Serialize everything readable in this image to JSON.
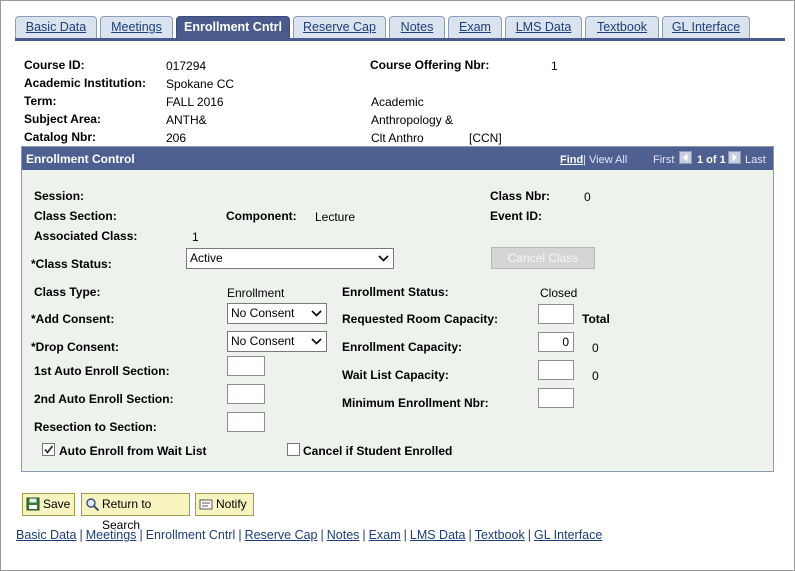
{
  "tabs": [
    {
      "label": "Basic Data",
      "active": false
    },
    {
      "label": "Meetings",
      "active": false
    },
    {
      "label": "Enrollment Cntrl",
      "active": true
    },
    {
      "label": "Reserve Cap",
      "active": false
    },
    {
      "label": "Notes",
      "active": false
    },
    {
      "label": "Exam",
      "active": false
    },
    {
      "label": "LMS Data",
      "active": false
    },
    {
      "label": "Textbook",
      "active": false
    },
    {
      "label": "GL Interface",
      "active": false
    }
  ],
  "header": {
    "course_id_label": "Course ID:",
    "course_id": "017294",
    "course_offering_label": "Course Offering Nbr:",
    "course_offering": "1",
    "institution_label": "Academic Institution:",
    "institution": "Spokane CC",
    "term_label": "Term:",
    "term": "FALL 2016",
    "term_extra": "Academic",
    "subject_label": "Subject Area:",
    "subject": "ANTH&",
    "subject_extra": "Anthropology &",
    "catalog_label": "Catalog Nbr:",
    "catalog": "206",
    "catalog_extra": "Clt Anthro",
    "catalog_tag": "[CCN]"
  },
  "enrollment": {
    "title": "Enrollment Control",
    "nav": {
      "find": "Find",
      "view_all": "View All",
      "first": "First",
      "pos": "1 of 1",
      "last": "Last",
      "sep": "|"
    },
    "session_label": "Session:",
    "class_nbr_label": "Class Nbr:",
    "class_nbr": "0",
    "class_section_label": "Class Section:",
    "component_label": "Component:",
    "component": "Lecture",
    "event_id_label": "Event ID:",
    "assoc_class_label": "Associated Class:",
    "assoc_class": "1",
    "class_status_label": "*Class Status:",
    "class_status": "Active",
    "cancel_class": "Cancel Class",
    "class_type_label": "Class Type:",
    "class_type": "Enrollment",
    "enroll_status_label": "Enrollment Status:",
    "enroll_status": "Closed",
    "add_consent_label": "*Add Consent:",
    "add_consent": "No Consent",
    "req_room_label": "Requested Room Capacity:",
    "req_room": "",
    "total_label": "Total",
    "drop_consent_label": "*Drop Consent:",
    "drop_consent": "No Consent",
    "enroll_cap_label": "Enrollment Capacity:",
    "enroll_cap": "0",
    "enroll_total": "0",
    "auto1_label": "1st Auto Enroll Section:",
    "auto1": "",
    "waitlist_label": "Wait List Capacity:",
    "waitlist": "",
    "waitlist_total": "0",
    "auto2_label": "2nd Auto Enroll Section:",
    "auto2": "",
    "min_enroll_label": "Minimum Enrollment Nbr:",
    "min_enroll": "",
    "resection_label": "Resection to Section:",
    "resection": "",
    "auto_waitlist_label": "Auto Enroll from Wait List",
    "auto_waitlist_checked": true,
    "cancel_if_label": "Cancel if Student Enrolled",
    "cancel_if_checked": false
  },
  "buttons": {
    "save": "Save",
    "return": "Return to Search",
    "notify": "Notify"
  },
  "footer": {
    "links": [
      "Basic Data",
      "Meetings",
      "Enrollment Cntrl",
      "Reserve Cap",
      "Notes",
      "Exam",
      "LMS Data",
      "Textbook",
      "GL Interface"
    ],
    "sep": "|"
  },
  "colors": {
    "tab_active": "#4a5a8c",
    "tab_inactive": "#dbe3ef",
    "panel_body": "#edf3ec",
    "button_bg": "#f8f4c0"
  }
}
